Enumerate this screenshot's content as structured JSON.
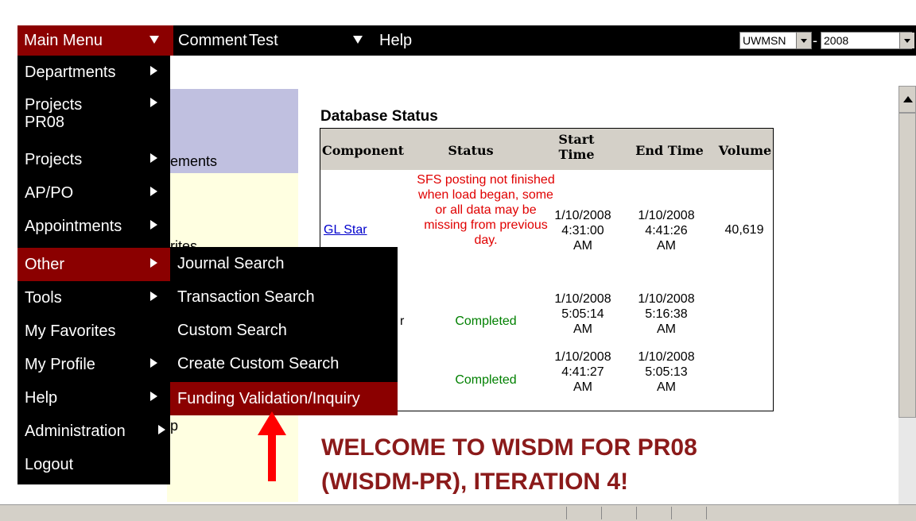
{
  "topbar": {
    "main_menu": "Main Menu",
    "comment": "Comment",
    "test": "Test",
    "help": "Help",
    "campus_select": "UWMSN",
    "separator": "-",
    "year_select": "2008"
  },
  "main_menu_items": [
    {
      "label": "Departments",
      "arrow": true
    },
    {
      "label": "Projects PR08",
      "arrow": true
    },
    {
      "label": "Projects",
      "arrow": true
    },
    {
      "label": "AP/PO",
      "arrow": true
    },
    {
      "label": "Appointments",
      "arrow": true
    },
    {
      "label": "Other",
      "arrow": true,
      "highlighted": true
    },
    {
      "label": "Tools",
      "arrow": true
    },
    {
      "label": "My Favorites",
      "arrow": false
    },
    {
      "label": "My Profile",
      "arrow": true
    },
    {
      "label": "Help",
      "arrow": true
    },
    {
      "label": "Administration",
      "arrow": true
    },
    {
      "label": "Logout",
      "arrow": false
    }
  ],
  "other_submenu": [
    {
      "label": "Journal Search",
      "arrow": false
    },
    {
      "label": "Transaction Search",
      "arrow": false
    },
    {
      "label": "Custom Search",
      "arrow": false
    },
    {
      "label": "Create Custom Search",
      "arrow": false
    },
    {
      "label": "Funding Validation/Inquiry",
      "highlighted": true
    }
  ],
  "side_panel": {
    "partial_1": "ements",
    "partial_2": "rites",
    "partial_3": "p"
  },
  "database_status": {
    "title": "Database Status",
    "headers": [
      "Component",
      "Status",
      "Start Time",
      "End Time",
      "Volume"
    ],
    "rows": [
      {
        "component": "GL Star",
        "status": "SFS posting not finished when load began, some or all data may be missing from previous day.",
        "status_color": "#e00000",
        "start": "1/10/2008 4:31:00 AM",
        "end": "1/10/2008 4:41:26 AM",
        "volume": "40,619"
      },
      {
        "component": "r",
        "status": "Completed",
        "status_color": "#008000",
        "start": "1/10/2008 5:05:14 AM",
        "end": "1/10/2008 5:16:38 AM",
        "volume": ""
      },
      {
        "component": "",
        "status": "Completed",
        "status_color": "#008000",
        "start": "1/10/2008 4:41:27 AM",
        "end": "1/10/2008 5:05:13 AM",
        "volume": ""
      }
    ]
  },
  "welcome": {
    "line1": "WELCOME TO WISDM FOR PR08",
    "line2": "(WISDM-PR), ITERATION 4!"
  },
  "colors": {
    "menu_bg": "#000000",
    "highlight": "#8b0000",
    "welcome": "#8b1a1a",
    "arrow": "#ff0000"
  },
  "icons": {
    "main_menu_dropdown": "triangle-down-icon",
    "comment_dropdown": "triangle-down-icon",
    "submenu_arrow": "triangle-right-icon",
    "annotation_arrow": "red-up-arrow-icon"
  }
}
